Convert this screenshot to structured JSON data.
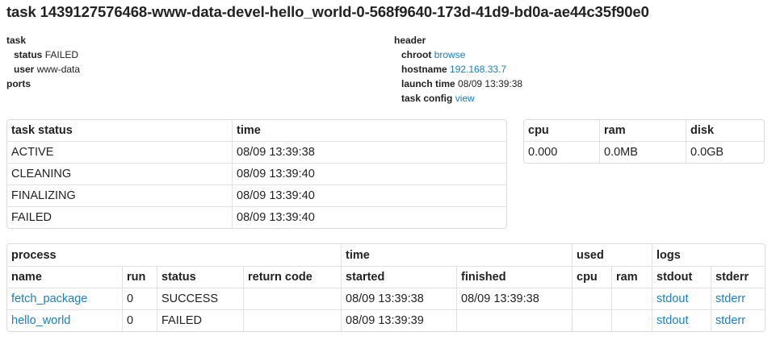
{
  "page_title": "task 1439127576468-www-data-devel-hello_world-0-568f9640-173d-41d9-bd0a-ae44c35f90e0",
  "task_meta": {
    "heading": "task",
    "status_label": "status",
    "status_value": "FAILED",
    "user_label": "user",
    "user_value": "www-data",
    "ports_label": "ports"
  },
  "header_meta": {
    "heading": "header",
    "chroot_label": "chroot",
    "chroot_link": "browse",
    "hostname_label": "hostname",
    "hostname_link": "192.168.33.7",
    "launch_label": "launch time",
    "launch_value": "08/09 13:39:38",
    "config_label": "task config",
    "config_link": "view"
  },
  "status_table": {
    "headers": [
      "task status",
      "time"
    ],
    "rows": [
      [
        "ACTIVE",
        "08/09 13:39:38"
      ],
      [
        "CLEANING",
        "08/09 13:39:40"
      ],
      [
        "FINALIZING",
        "08/09 13:39:40"
      ],
      [
        "FAILED",
        "08/09 13:39:40"
      ]
    ]
  },
  "resource_table": {
    "headers": [
      "cpu",
      "ram",
      "disk"
    ],
    "values": [
      "0.000",
      "0.0MB",
      "0.0GB"
    ]
  },
  "process_table": {
    "group_headers": {
      "process": "process",
      "time": "time",
      "used": "used",
      "logs": "logs"
    },
    "columns": [
      "name",
      "run",
      "status",
      "return code",
      "started",
      "finished",
      "cpu",
      "ram",
      "stdout",
      "stderr"
    ],
    "rows": [
      {
        "name": "fetch_package",
        "run": "0",
        "status": "SUCCESS",
        "return_code": "",
        "started": "08/09 13:39:38",
        "finished": "08/09 13:39:38",
        "cpu": "",
        "ram": "",
        "stdout": "stdout",
        "stderr": "stderr"
      },
      {
        "name": "hello_world",
        "run": "0",
        "status": "FAILED",
        "return_code": "",
        "started": "08/09 13:39:39",
        "finished": "",
        "cpu": "",
        "ram": "",
        "stdout": "stdout",
        "stderr": "stderr"
      }
    ]
  }
}
